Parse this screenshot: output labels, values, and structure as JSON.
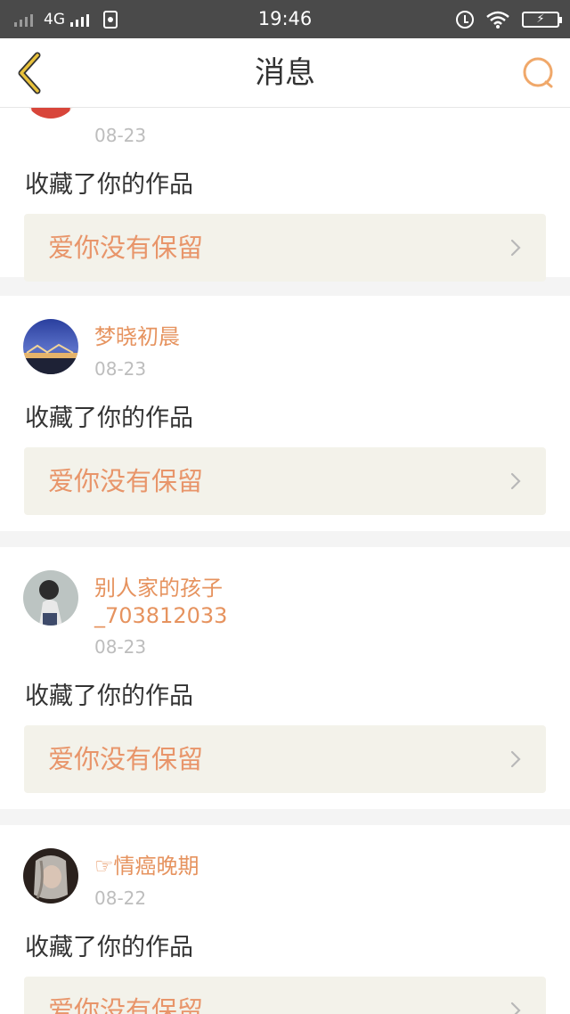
{
  "status_bar": {
    "network": "4G",
    "time": "19:46",
    "icons": [
      "signal-icon",
      "signal-icon",
      "sim-icon",
      "alarm-icon",
      "wifi-icon",
      "battery-charging-icon"
    ]
  },
  "nav": {
    "title": "消息",
    "back_icon": "chevron-left-icon",
    "search_icon": "search-icon",
    "accent_color": "#e9a23b"
  },
  "feed": {
    "items": [
      {
        "user": "",
        "date": "08-23",
        "action": "收藏了你的作品",
        "work_title": "爱你没有保留"
      },
      {
        "user": "梦晓初晨",
        "date": "08-23",
        "action": "收藏了你的作品",
        "work_title": "爱你没有保留"
      },
      {
        "user": "别人家的孩子_703812033",
        "user_line1": "别人家的孩子",
        "user_line2": "_703812033",
        "date": "08-23",
        "action": "收藏了你的作品",
        "work_title": "爱你没有保留"
      },
      {
        "user": "☞情癌晚期",
        "date": "08-22",
        "action": "收藏了你的作品",
        "work_title": "爱你没有保留"
      }
    ]
  },
  "colors": {
    "username": "#e6935f",
    "work_title": "#e8956a",
    "date": "#bdbdbd",
    "work_bg": "#f3f2ea",
    "separator": "#f4f4f4"
  }
}
